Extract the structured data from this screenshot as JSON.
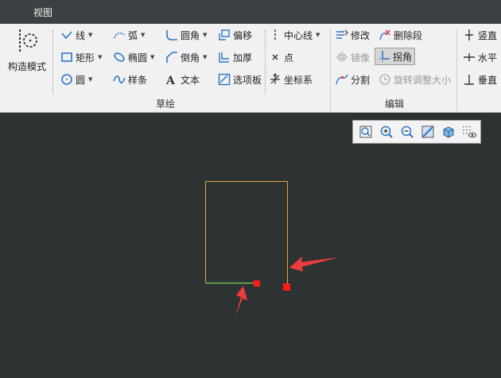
{
  "menubar": {
    "view_label": "视图"
  },
  "ribbon": {
    "construct_mode": "构造模式",
    "sketch": {
      "group_label": "草绘",
      "line": "线",
      "rect": "矩形",
      "circle": "圆",
      "arc": "弧",
      "ellipse": "椭圆",
      "spline": "样条",
      "fillet": "圆角",
      "chamfer": "倒角",
      "text": "文本",
      "offset": "偏移",
      "thicken": "加厚",
      "palette": "选项板",
      "centerline": "中心线",
      "point": "点",
      "coord_sys": "坐标系"
    },
    "edit": {
      "group_label": "编辑",
      "modify": "修改",
      "delete_segment": "删除段",
      "mirror": "镜像",
      "corner": "拐角",
      "divide": "分割",
      "rotate_resize": "旋转调整大小"
    },
    "constrain": {
      "vertical": "竖直",
      "horizontal": "水平",
      "perpendicular": "垂直"
    }
  },
  "view_toolbar": {
    "icons": [
      "refit-icon",
      "zoom-in-icon",
      "zoom-out-icon",
      "repaint-icon",
      "display-style-icon",
      "sketcher-display-filter-icon"
    ]
  },
  "colors": {
    "canvas_bg": "#2d3233",
    "sketch_orange": "#e8a63a",
    "sketch_green": "#7bd35a",
    "highlight_red": "#ff1a1a",
    "arrow_red": "#ee3b3b",
    "icon_blue": "#2b76c6"
  }
}
